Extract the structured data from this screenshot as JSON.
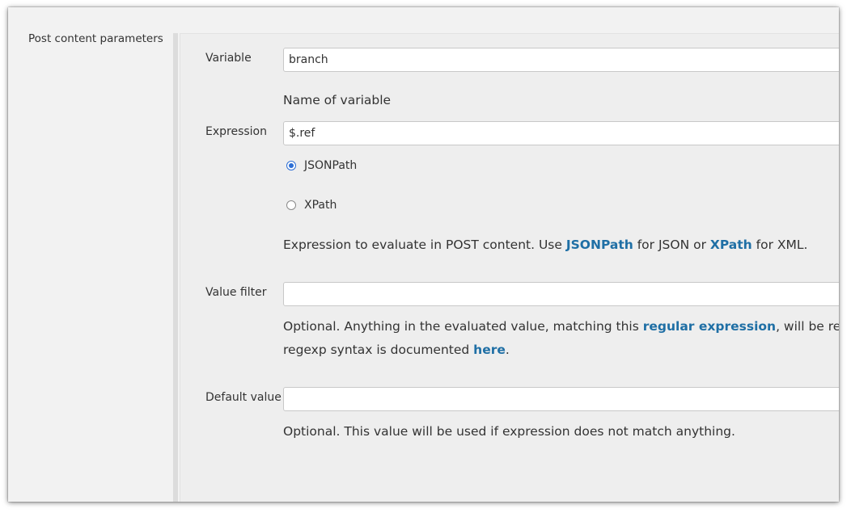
{
  "section": {
    "title": "Post content parameters"
  },
  "variable": {
    "label": "Variable",
    "value": "branch",
    "help": "Name of variable"
  },
  "expression": {
    "label": "Expression",
    "value": "$.ref",
    "options": [
      {
        "label": "JSONPath",
        "checked": true
      },
      {
        "label": "XPath",
        "checked": false
      }
    ],
    "help_prefix": "Expression to evaluate in POST content. Use ",
    "help_link1": "JSONPath",
    "help_mid": " for JSON or ",
    "help_link2": "XPath",
    "help_suffix": " for XML."
  },
  "value_filter": {
    "label": "Value filter",
    "value": "",
    "help_line1_prefix": "Optional. Anything in the evaluated value, matching this ",
    "help_line1_link": "regular expression",
    "help_line1_suffix": ", will be removed. I",
    "help_line2_prefix": "regexp syntax is documented ",
    "help_line2_link": "here",
    "help_line2_suffix": "."
  },
  "default_value": {
    "label": "Default value",
    "value": "",
    "help": "Optional. This value will be used if expression does not match anything."
  },
  "colors": {
    "link": "#1f6fa5",
    "radio_accent": "#2c6ed5"
  }
}
